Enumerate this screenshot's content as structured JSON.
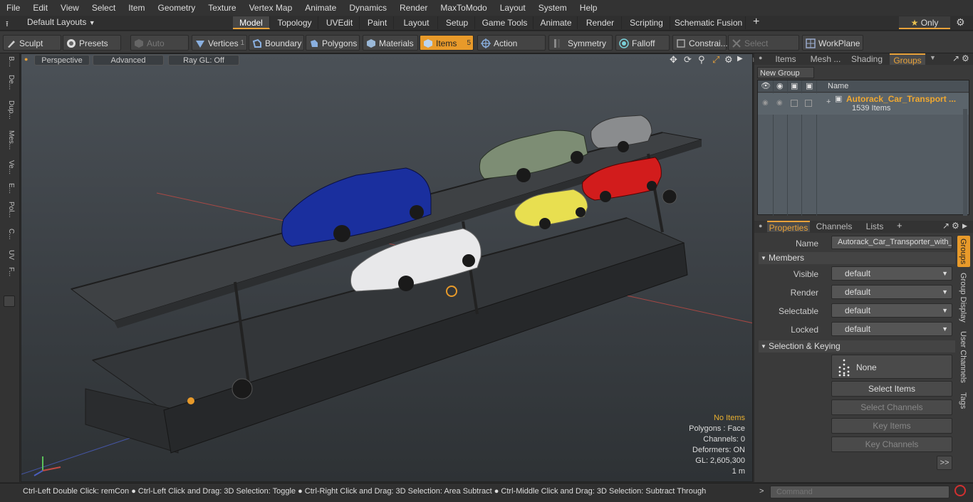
{
  "menu": [
    "File",
    "Edit",
    "View",
    "Select",
    "Item",
    "Geometry",
    "Texture",
    "Vertex Map",
    "Animate",
    "Dynamics",
    "Render",
    "MaxToModo",
    "Layout",
    "System",
    "Help"
  ],
  "layout": {
    "preset_label": "Default Layouts",
    "tabs": [
      "Model",
      "Topology",
      "UVEdit",
      "Paint",
      "Layout",
      "Setup",
      "Game Tools",
      "Animate",
      "Render",
      "Scripting",
      "Schematic Fusion"
    ],
    "active_tab": "Model",
    "plus": "+",
    "only_label": "Only"
  },
  "toolbar": {
    "sculpt": "Sculpt",
    "presets": "Presets",
    "auto_select": "Auto Select",
    "vertices": "Vertices",
    "vertices_count": "1",
    "boundary": "Boundary",
    "polygons": "Polygons",
    "materials": "Materials",
    "items": "Items",
    "items_count": "5",
    "action_center": "Action Center",
    "symmetry": "Symmetry",
    "falloff": "Falloff",
    "constraints": "Constrai...",
    "select_through": "Select Through",
    "workplane": "WorkPlane"
  },
  "left_strip": [
    "B...",
    "De...",
    "Dup...",
    "Mes...",
    "Ve...",
    "E...",
    "Pol...",
    "C...",
    "UV",
    "F..."
  ],
  "viewport": {
    "perspective": "Perspective",
    "advanced": "Advanced",
    "raygl": "Ray GL: Off",
    "stats": {
      "no_items": "No Items",
      "polygons": "Polygons : Face",
      "channels": "Channels: 0",
      "deformers": "Deformers: ON",
      "gl": "GL: 2,605,300",
      "scale": "1 m"
    }
  },
  "right_panel": {
    "top_tabs": [
      "Items",
      "Mesh ...",
      "Shading",
      "Groups"
    ],
    "active_top_tab": "Groups",
    "new_group": "New Group",
    "name_header": "Name",
    "group_name": "Autorack_Car_Transport ...",
    "group_count": "1539 Items",
    "bottom_tabs": [
      "Properties",
      "Channels",
      "Lists"
    ],
    "active_bottom_tab": "Properties",
    "name_label": "Name",
    "name_value": "Autorack_Car_Transporter_with_",
    "members_section": "Members",
    "fields": [
      {
        "label": "Visible",
        "value": "default"
      },
      {
        "label": "Render",
        "value": "default"
      },
      {
        "label": "Selectable",
        "value": "default"
      },
      {
        "label": "Locked",
        "value": "default"
      }
    ],
    "selection_section": "Selection & Keying",
    "none_label": "None",
    "select_items": "Select Items",
    "select_channels": "Select Channels",
    "key_items": "Key Items",
    "key_channels": "Key Channels",
    "more": ">>",
    "side_tabs": [
      "Groups",
      "Group Display",
      "User Channels",
      "Tags"
    ]
  },
  "status": {
    "hint": "Ctrl-Left Double Click: remCon ● Ctrl-Left Click and Drag: 3D Selection: Toggle ● Ctrl-Right Click and Drag: 3D Selection: Area Subtract ● Ctrl-Middle Click and Drag: 3D Selection: Subtract Through",
    "command_placeholder": "Command"
  },
  "colors": {
    "accent": "#e8a23a",
    "blue_van": "#1a2f9e",
    "red_car": "#d21c1c",
    "yellow_car": "#e8df50",
    "green_truck": "#7d8d74"
  }
}
